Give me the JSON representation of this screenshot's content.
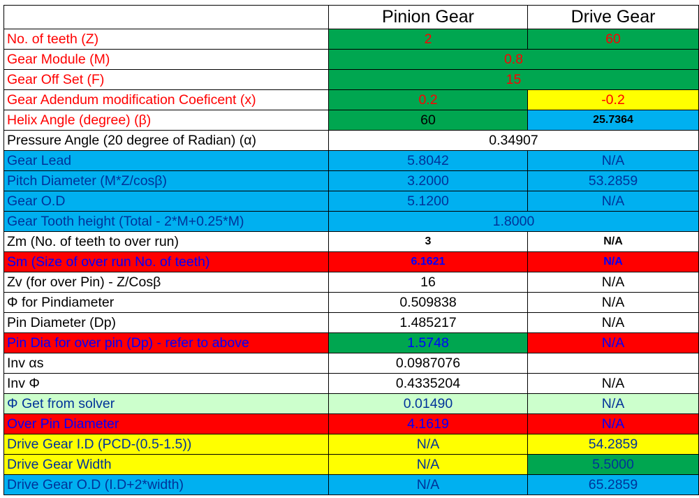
{
  "header": {
    "blank": "",
    "col1": "Pinion Gear",
    "col2": "Drive Gear"
  },
  "palette": {
    "green": "#00a650",
    "yellow": "#ffff00",
    "cyan": "#00b0f0",
    "red": "#ff0000",
    "light_green": "#ccffcc",
    "white": "#ffffff",
    "text_red": "#ff0000",
    "text_blue": "#0000ff",
    "text_navy": "#003399",
    "text_black": "#000000"
  },
  "rows": [
    {
      "label": "No. of teeth (Z)",
      "label_bg": "white",
      "label_color": "text_red",
      "cells": [
        {
          "text": "2",
          "bg": "green",
          "color": "text_red"
        },
        {
          "text": "60",
          "bg": "green",
          "color": "text_red"
        }
      ]
    },
    {
      "label": "Gear Module (M)",
      "label_bg": "white",
      "label_color": "text_red",
      "cells": [
        {
          "text": "0.8",
          "bg": "green",
          "color": "text_red",
          "span": 2
        }
      ]
    },
    {
      "label": "Gear Off Set (F)",
      "label_bg": "white",
      "label_color": "text_red",
      "cells": [
        {
          "text": "15",
          "bg": "green",
          "color": "text_red",
          "span": 2
        }
      ]
    },
    {
      "label": "Gear Adendum modification Coeficent (x)",
      "label_bg": "white",
      "label_color": "text_red",
      "cells": [
        {
          "text": "0.2",
          "bg": "green",
          "color": "text_red"
        },
        {
          "text": "-0.2",
          "bg": "yellow",
          "color": "text_red"
        }
      ]
    },
    {
      "label": "Helix Angle (degree) (β)",
      "label_bg": "white",
      "label_color": "text_red",
      "cells": [
        {
          "text": "60",
          "bg": "green",
          "color": "text_black"
        },
        {
          "text": "25.7364",
          "bg": "cyan",
          "color": "text_black",
          "bold": true,
          "small": true
        }
      ]
    },
    {
      "label": "Pressure Angle (20 degree of Radian) (α)",
      "label_bg": "white",
      "label_color": "text_black",
      "cells": [
        {
          "text": "0.34907",
          "bg": "white",
          "color": "text_black",
          "span": 2
        }
      ]
    },
    {
      "label": "Gear Lead",
      "label_bg": "cyan",
      "label_color": "text_navy",
      "cells": [
        {
          "text": "5.8042",
          "bg": "cyan",
          "color": "text_navy"
        },
        {
          "text": "N/A",
          "bg": "cyan",
          "color": "text_navy"
        }
      ]
    },
    {
      "label": "Pitch Diameter (M*Z/cosβ)",
      "label_bg": "cyan",
      "label_color": "text_navy",
      "cells": [
        {
          "text": "3.2000",
          "bg": "cyan",
          "color": "text_navy"
        },
        {
          "text": "53.2859",
          "bg": "cyan",
          "color": "text_navy"
        }
      ]
    },
    {
      "label": "Gear O.D",
      "label_bg": "cyan",
      "label_color": "text_navy",
      "cells": [
        {
          "text": "5.1200",
          "bg": "cyan",
          "color": "text_navy"
        },
        {
          "text": "N/A",
          "bg": "cyan",
          "color": "text_navy"
        }
      ]
    },
    {
      "label": "Gear Tooth height (Total - 2*M+0.25*M)",
      "label_bg": "cyan",
      "label_color": "text_navy",
      "cells": [
        {
          "text": "1.8000",
          "bg": "cyan",
          "color": "text_navy",
          "span": 2
        }
      ]
    },
    {
      "label": "Zm (No. of teeth to over run)",
      "label_bg": "white",
      "label_color": "text_black",
      "cells": [
        {
          "text": "3",
          "bg": "white",
          "color": "text_black",
          "bold": true,
          "small": true
        },
        {
          "text": "N/A",
          "bg": "white",
          "color": "text_black",
          "bold": true,
          "small": true
        }
      ]
    },
    {
      "label": "Sm (Size of over run No. of teeth)",
      "label_bg": "red",
      "label_color": "text_blue",
      "cells": [
        {
          "text": "6.1621",
          "bg": "red",
          "color": "text_blue",
          "bold": true,
          "small": true
        },
        {
          "text": "N/A",
          "bg": "red",
          "color": "text_blue",
          "bold": true,
          "small": true
        }
      ]
    },
    {
      "label": "Zv (for over Pin) - Z/Cosβ",
      "label_bg": "white",
      "label_color": "text_black",
      "cells": [
        {
          "text": "16",
          "bg": "white",
          "color": "text_black"
        },
        {
          "text": "N/A",
          "bg": "white",
          "color": "text_black"
        }
      ]
    },
    {
      "label": "Φ for Pindiameter",
      "label_bg": "white",
      "label_color": "text_black",
      "cells": [
        {
          "text": "0.509838",
          "bg": "white",
          "color": "text_black"
        },
        {
          "text": "N/A",
          "bg": "white",
          "color": "text_black"
        }
      ]
    },
    {
      "label": "Pin Diameter (Dp)",
      "label_bg": "white",
      "label_color": "text_black",
      "cells": [
        {
          "text": "1.485217",
          "bg": "white",
          "color": "text_black"
        },
        {
          "text": "N/A",
          "bg": "white",
          "color": "text_black"
        }
      ]
    },
    {
      "label": "Pin Dia for over pin (Dp) - refer to above",
      "label_bg": "red",
      "label_color": "text_blue",
      "cells": [
        {
          "text": "1.5748",
          "bg": "green",
          "color": "text_blue"
        },
        {
          "text": "N/A",
          "bg": "red",
          "color": "text_blue"
        }
      ]
    },
    {
      "label": "Inv αs",
      "label_bg": "white",
      "label_color": "text_black",
      "cells": [
        {
          "text": "0.0987076",
          "bg": "white",
          "color": "text_black"
        },
        {
          "text": "",
          "bg": "white",
          "color": "text_black"
        }
      ]
    },
    {
      "label": "Inv Φ",
      "label_bg": "white",
      "label_color": "text_black",
      "cells": [
        {
          "text": "0.4335204",
          "bg": "white",
          "color": "text_black"
        },
        {
          "text": "N/A",
          "bg": "white",
          "color": "text_black"
        }
      ]
    },
    {
      "label": "Φ Get from solver",
      "label_bg": "light_green",
      "label_color": "text_navy",
      "cells": [
        {
          "text": "0.01490",
          "bg": "light_green",
          "color": "text_navy"
        },
        {
          "text": "N/A",
          "bg": "light_green",
          "color": "text_navy"
        }
      ]
    },
    {
      "label": "Over Pin Diameter",
      "label_bg": "red",
      "label_color": "text_blue",
      "cells": [
        {
          "text": "4.1619",
          "bg": "red",
          "color": "text_blue"
        },
        {
          "text": "N/A",
          "bg": "red",
          "color": "text_blue"
        }
      ]
    },
    {
      "label": "Drive Gear I.D (PCD-(0.5-1.5))",
      "label_bg": "yellow",
      "label_color": "text_navy",
      "cells": [
        {
          "text": "N/A",
          "bg": "yellow",
          "color": "text_navy"
        },
        {
          "text": "54.2859",
          "bg": "yellow",
          "color": "text_navy"
        }
      ]
    },
    {
      "label": "Drive Gear Width",
      "label_bg": "yellow",
      "label_color": "text_navy",
      "cells": [
        {
          "text": "N/A",
          "bg": "yellow",
          "color": "text_navy"
        },
        {
          "text": "5.5000",
          "bg": "green",
          "color": "text_navy"
        }
      ]
    },
    {
      "label": "Drive Gear O.D (I.D+2*width)",
      "label_bg": "cyan",
      "label_color": "text_navy",
      "cells": [
        {
          "text": "N/A",
          "bg": "cyan",
          "color": "text_navy"
        },
        {
          "text": "65.2859",
          "bg": "cyan",
          "color": "text_navy"
        }
      ]
    }
  ]
}
